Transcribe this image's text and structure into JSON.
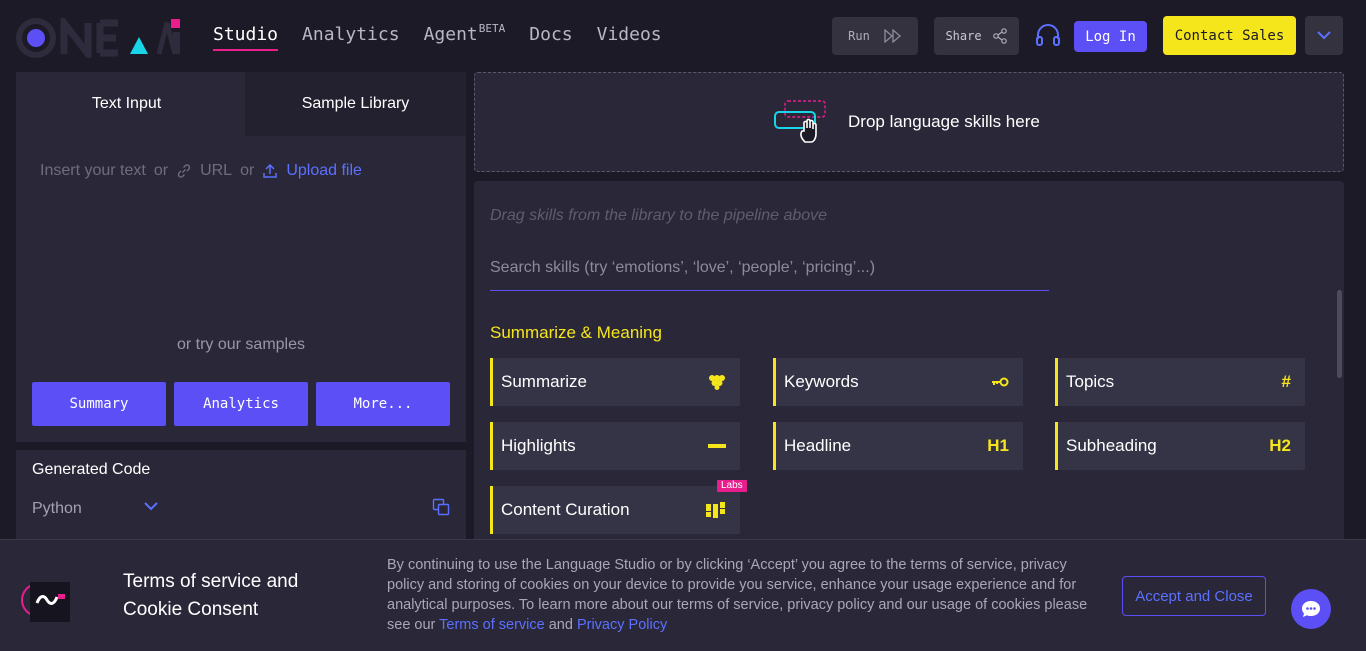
{
  "header": {
    "logo_text": "ONEAI",
    "nav": [
      {
        "label": "Studio"
      },
      {
        "label": "Analytics"
      },
      {
        "label": "Agent",
        "badge": "BETA"
      },
      {
        "label": "Docs"
      },
      {
        "label": "Videos"
      }
    ],
    "run_label": "Run",
    "share_label": "Share",
    "login_label": "Log In",
    "contact_label": "Contact Sales"
  },
  "input_panel": {
    "tabs": [
      "Text Input",
      "Sample Library"
    ],
    "placeholder_text": "Insert your text",
    "or1": "or",
    "url_label": "URL",
    "or2": "or",
    "upload_label": "Upload file",
    "samples_label": "or try our samples",
    "sample_buttons": [
      "Summary",
      "Analytics",
      "More..."
    ]
  },
  "code_panel": {
    "title": "Generated Code",
    "language": "Python"
  },
  "dropzone": {
    "text": "Drop language skills here"
  },
  "skills_panel": {
    "hint": "Drag skills from the library to the pipeline above",
    "search_placeholder": "Search skills (try ‘emotions’, ‘love’, ‘people’, ‘pricing’...)",
    "section_title": "Summarize & Meaning",
    "skills": [
      {
        "label": "Summarize",
        "icon": "summarize-icon"
      },
      {
        "label": "Keywords",
        "icon": "key-icon"
      },
      {
        "label": "Topics",
        "icon": "hash-icon",
        "icon_text": "#"
      },
      {
        "label": "Highlights",
        "icon": "highlight-icon"
      },
      {
        "label": "Headline",
        "icon": "h1-icon",
        "icon_text": "H1"
      },
      {
        "label": "Subheading",
        "icon": "h2-icon",
        "icon_text": "H2"
      },
      {
        "label": "Content Curation",
        "icon": "curation-icon",
        "badge": "Labs"
      }
    ]
  },
  "cookie": {
    "title": "Terms of service and Cookie Consent",
    "text_before": "By continuing to use the Language Studio or by clicking ‘Accept’ you agree to the terms of service, privacy policy and storing of cookies on your device to provide you service, enhance your usage experience and for analytical purposes. To learn more about our terms of service, privacy policy and our usage of cookies please see our ",
    "terms_link": "Terms of service",
    "and": " and ",
    "privacy_link": "Privacy Policy",
    "accept_label": "Accept and Close"
  },
  "colors": {
    "accent": "#5b4ff5",
    "yellow": "#f5e61c",
    "pink": "#e91e8c",
    "cyan": "#18d5e8",
    "background": "#1c1a27",
    "panel": "#2a2838"
  }
}
